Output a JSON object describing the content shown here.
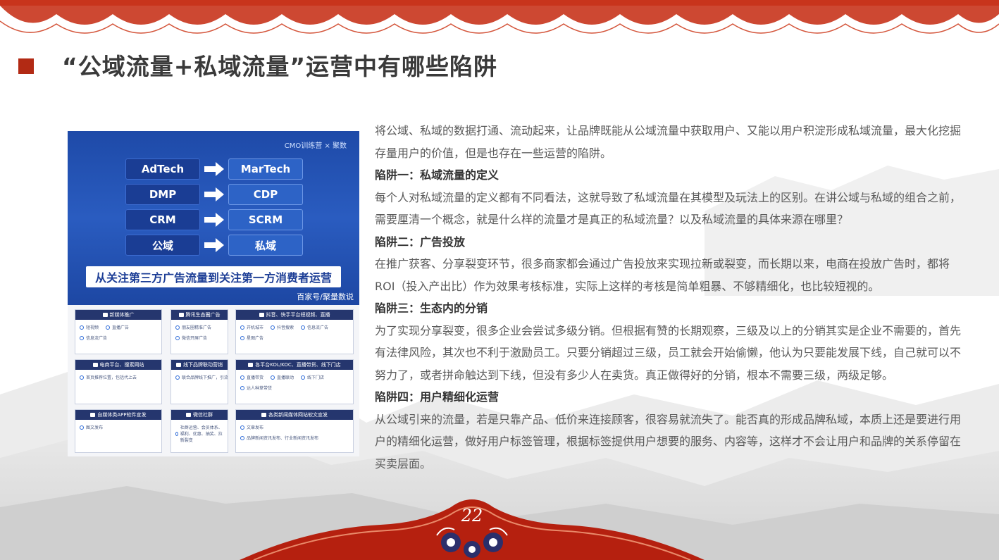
{
  "title": "“公域流量+私域流量”运营中有哪些陷阱",
  "page_number": "22",
  "colors": {
    "accent": "#b22a14",
    "banner_blue": "#1e4aa8",
    "card_header": "#25366e"
  },
  "figure": {
    "logo": "CMO训练营 × 聚数",
    "rows": [
      {
        "left": "AdTech",
        "right": "MarTech"
      },
      {
        "left": "DMP",
        "right": "CDP"
      },
      {
        "left": "CRM",
        "right": "SCRM"
      },
      {
        "left": "公域",
        "right": "私域"
      }
    ],
    "slogan": "从关注第三方广告流量到关注第一方消费者运营",
    "source": "百家号/聚量数说",
    "cards": [
      {
        "title": "新媒体推广",
        "items": [
          "短视频",
          "直播广告",
          "信息流广告"
        ]
      },
      {
        "title": "腾讯生态圈广告",
        "items": [
          "朋友圈精准广告",
          "微信开屏广告"
        ]
      },
      {
        "title": "抖音、快手平台短视频、直播",
        "items": [
          "开机城市",
          "抖音搜索",
          "信息流广告",
          "星图广告"
        ]
      },
      {
        "title": "电商平台、搜索网站",
        "items": [
          "首页推荐位置，包括代上去"
        ]
      },
      {
        "title": "线下品牌联动营销",
        "items": [
          "联合品牌线下推广，引流活动"
        ]
      },
      {
        "title": "各平台KOL/KOC、直播带货、线下门店",
        "items": [
          "直播带货",
          "直播联动",
          "线下门店",
          "达人种草带货"
        ]
      },
      {
        "title": "自媒体类APP软件宣发",
        "items": [
          "图文发布"
        ]
      },
      {
        "title": "微信社群",
        "items": [
          "社群运营、会员体系、福利、优惠、抽奖、拉新裂变"
        ]
      },
      {
        "title": "各类新闻媒体网站软文宣发",
        "items": [
          "文章发布",
          "品牌新闻资讯发布、行业新闻资讯发布"
        ]
      }
    ]
  },
  "content": {
    "intro": "将公域、私域的数据打通、流动起来，让品牌既能从公域流量中获取用户、又能以用户积淀形成私域流量，最大化挖掘存量用户的价值，但是也存在一些运营的陷阱。",
    "sections": [
      {
        "heading": "陷阱一：私域流量的定义",
        "body": "每个人对私域流量的定义都有不同看法，这就导致了私域流量在其模型及玩法上的区别。在讲公域与私域的组合之前，需要厘清一个概念，就是什么样的流量才是真正的私域流量？以及私域流量的具体来源在哪里？"
      },
      {
        "heading": "陷阱二：广告投放",
        "body": "在推广获客、分享裂变环节，很多商家都会通过广告投放来实现拉新或裂变，而长期以来，电商在投放广告时，都将ROI（投入产出比）作为效果考核标准，实际上这样的考核是简单粗暴、不够精细化，也比较短视的。"
      },
      {
        "heading": "陷阱三：生态内的分销",
        "body": "为了实现分享裂变，很多企业会尝试多级分销。但根据有赞的长期观察，三级及以上的分销其实是企业不需要的，首先有法律风险，其次也不利于激励员工。只要分销超过三级，员工就会开始偷懒，他认为只要能发展下线，自己就可以不努力了，或者拼命触达到下线，但没有多少人在卖货。真正做得好的分销，根本不需要三级，两级足够。"
      },
      {
        "heading": "陷阱四：用户精细化运营",
        "body": "从公域引来的流量，若是只靠产品、低价来连接顾客，很容易就流失了。能否真的形成品牌私域，本质上还是要进行用户的精细化运营，做好用户标签管理，根据标签提供用户想要的服务、内容等，这样才不会让用户和品牌的关系停留在买卖层面。"
      }
    ]
  }
}
